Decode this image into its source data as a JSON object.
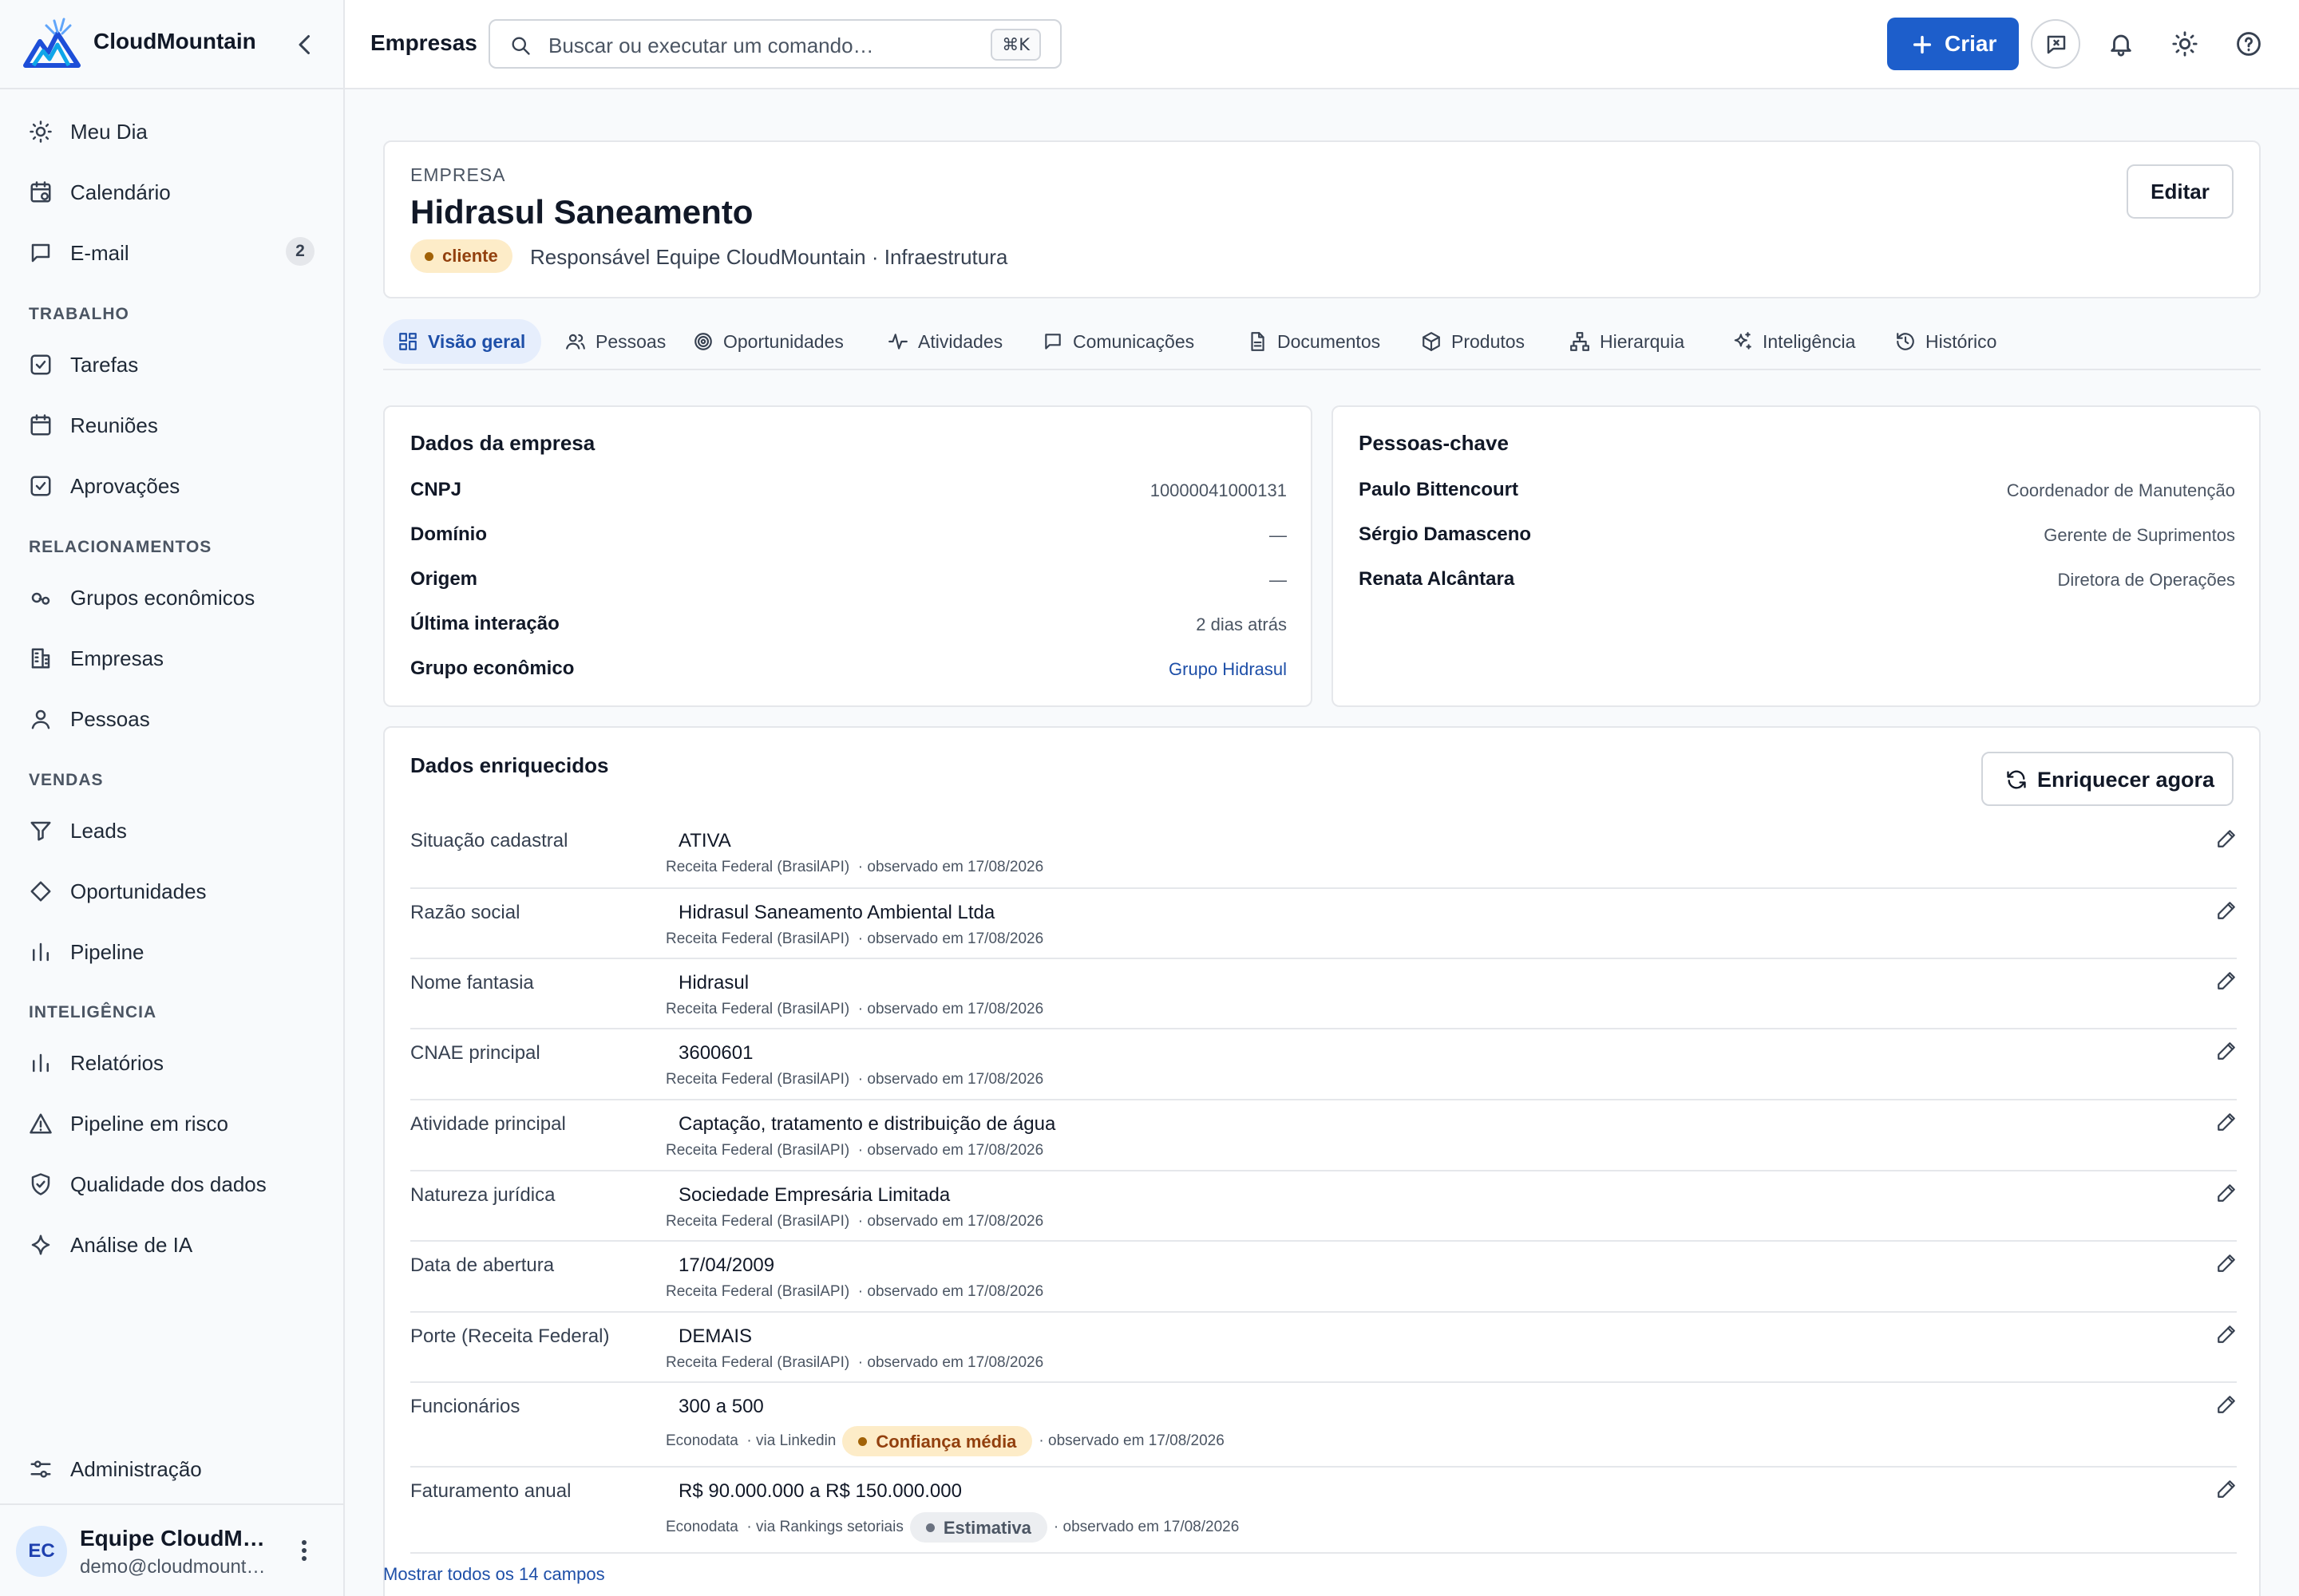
{
  "brand": {
    "name": "CloudMountain"
  },
  "sidebar": {
    "items_top": [
      {
        "label": "Meu Dia",
        "icon": "sun-icon"
      },
      {
        "label": "Calendário",
        "icon": "calendar-clock-icon"
      },
      {
        "label": "E-mail",
        "icon": "message-icon",
        "badge": "2"
      }
    ],
    "sections": [
      {
        "title": "TRABALHO",
        "items": [
          {
            "label": "Tarefas",
            "icon": "check-square-icon"
          },
          {
            "label": "Reuniões",
            "icon": "calendar-icon"
          },
          {
            "label": "Aprovações",
            "icon": "check-square-icon"
          }
        ]
      },
      {
        "title": "RELACIONAMENTOS",
        "items": [
          {
            "label": "Grupos econômicos",
            "icon": "link-icon"
          },
          {
            "label": "Empresas",
            "icon": "building-icon"
          },
          {
            "label": "Pessoas",
            "icon": "user-icon"
          }
        ]
      },
      {
        "title": "VENDAS",
        "items": [
          {
            "label": "Leads",
            "icon": "filter-icon"
          },
          {
            "label": "Oportunidades",
            "icon": "diamond-icon"
          },
          {
            "label": "Pipeline",
            "icon": "bar-chart-icon"
          }
        ]
      },
      {
        "title": "INTELIGÊNCIA",
        "items": [
          {
            "label": "Relatórios",
            "icon": "bar-chart-icon"
          },
          {
            "label": "Pipeline em risco",
            "icon": "alert-triangle-icon"
          },
          {
            "label": "Qualidade dos dados",
            "icon": "shield-check-icon"
          },
          {
            "label": "Análise de IA",
            "icon": "sparkle-icon"
          }
        ]
      }
    ],
    "admin": {
      "label": "Administração",
      "icon": "sliders-icon"
    },
    "user": {
      "initials": "EC",
      "name": "Equipe CloudMountain",
      "email": "demo@cloudmountain.com.br"
    }
  },
  "topbar": {
    "breadcrumb": "Empresas",
    "search_placeholder": "Buscar ou executar um comando…",
    "shortcut": "⌘K",
    "create_label": "Criar"
  },
  "company": {
    "kicker": "EMPRESA",
    "name": "Hidrasul Saneamento",
    "status": "cliente",
    "meta": "Responsável Equipe CloudMountain · Infraestrutura",
    "edit_label": "Editar"
  },
  "tabs": [
    {
      "label": "Visão geral",
      "icon": "grid-icon",
      "active": true
    },
    {
      "label": "Pessoas",
      "icon": "users-icon"
    },
    {
      "label": "Oportunidades",
      "icon": "target-icon"
    },
    {
      "label": "Atividades",
      "icon": "activity-icon"
    },
    {
      "label": "Comunicações",
      "icon": "message-icon"
    },
    {
      "label": "Documentos",
      "icon": "file-icon"
    },
    {
      "label": "Produtos",
      "icon": "package-icon"
    },
    {
      "label": "Hierarquia",
      "icon": "hierarchy-icon"
    },
    {
      "label": "Inteligência",
      "icon": "sparkles-icon"
    },
    {
      "label": "Histórico",
      "icon": "history-icon"
    }
  ],
  "company_data": {
    "title": "Dados da empresa",
    "fields": [
      {
        "label": "CNPJ",
        "value": "10000041000131"
      },
      {
        "label": "Domínio",
        "value": "—"
      },
      {
        "label": "Origem",
        "value": "—"
      },
      {
        "label": "Última interação",
        "value": "2 dias atrás"
      },
      {
        "label": "Grupo econômico",
        "value": "Grupo Hidrasul",
        "link": true
      }
    ]
  },
  "key_people": {
    "title": "Pessoas-chave",
    "people": [
      {
        "name": "Paulo Bittencourt",
        "role": "Coordenador de Manutenção"
      },
      {
        "name": "Sérgio Damasceno",
        "role": "Gerente de Suprimentos"
      },
      {
        "name": "Renata Alcântara",
        "role": "Diretora de Operações"
      }
    ]
  },
  "enriched": {
    "title": "Dados enriquecidos",
    "enrich_label": "Enriquecer agora",
    "rows": [
      {
        "label": "Situação cadastral",
        "value": "ATIVA",
        "source": "Receita Federal (BrasilAPI)",
        "observed": "· observado em 17/08/2026"
      },
      {
        "label": "Razão social",
        "value": "Hidrasul Saneamento Ambiental Ltda",
        "source": "Receita Federal (BrasilAPI)",
        "observed": "· observado em 17/08/2026"
      },
      {
        "label": "Nome fantasia",
        "value": "Hidrasul",
        "source": "Receita Federal (BrasilAPI)",
        "observed": "· observado em 17/08/2026"
      },
      {
        "label": "CNAE principal",
        "value": "3600601",
        "source": "Receita Federal (BrasilAPI)",
        "observed": "· observado em 17/08/2026"
      },
      {
        "label": "Atividade principal",
        "value": "Captação, tratamento e distribuição de água",
        "source": "Receita Federal (BrasilAPI)",
        "observed": "· observado em 17/08/2026"
      },
      {
        "label": "Natureza jurídica",
        "value": "Sociedade Empresária Limitada",
        "source": "Receita Federal (BrasilAPI)",
        "observed": "· observado em 17/08/2026"
      },
      {
        "label": "Data de abertura",
        "value": "17/04/2009",
        "source": "Receita Federal (BrasilAPI)",
        "observed": "· observado em 17/08/2026"
      },
      {
        "label": "Porte (Receita Federal)",
        "value": "DEMAIS",
        "source": "Receita Federal (BrasilAPI)",
        "observed": "· observado em 17/08/2026"
      },
      {
        "label": "Funcionários",
        "value": "300 a 500",
        "source": "Econodata",
        "via": "· via Linkedin",
        "chip": "Confiança média",
        "chip_style": "warn",
        "observed": "· observado em 17/08/2026"
      },
      {
        "label": "Faturamento anual",
        "value": "R$ 90.000.000 a R$ 150.000.000",
        "source": "Econodata",
        "via": "· via Rankings setoriais",
        "chip": "Estimativa",
        "chip_style": "gray",
        "observed": "· observado em 17/08/2026"
      }
    ],
    "show_all": "Mostrar todos os 14 campos"
  }
}
